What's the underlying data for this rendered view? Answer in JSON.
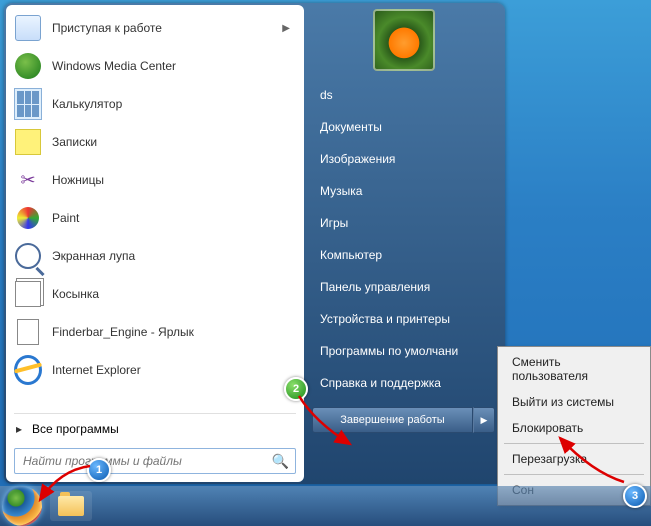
{
  "programs": [
    {
      "label": "Приступая к работе",
      "icon": "getting-started",
      "has_arrow": true
    },
    {
      "label": "Windows Media Center",
      "icon": "wmc",
      "has_arrow": false
    },
    {
      "label": "Калькулятор",
      "icon": "calc",
      "has_arrow": false
    },
    {
      "label": "Записки",
      "icon": "notes",
      "has_arrow": false
    },
    {
      "label": "Ножницы",
      "icon": "scissors",
      "has_arrow": false
    },
    {
      "label": "Paint",
      "icon": "paint",
      "has_arrow": false
    },
    {
      "label": "Экранная лупа",
      "icon": "magnifier",
      "has_arrow": false
    },
    {
      "label": "Косынка",
      "icon": "solitaire",
      "has_arrow": false
    },
    {
      "label": "Finderbar_Engine - Ярлык",
      "icon": "shortcut",
      "has_arrow": false
    },
    {
      "label": "Internet Explorer",
      "icon": "ie",
      "has_arrow": false
    }
  ],
  "all_programs": "Все программы",
  "search_placeholder": "Найти программы и файлы",
  "right_items": [
    "ds",
    "Документы",
    "Изображения",
    "Музыка",
    "Игры",
    "Компьютер",
    "Панель управления",
    "Устройства и принтеры",
    "Программы по умолчани",
    "Справка и поддержка"
  ],
  "shutdown_label": "Завершение работы",
  "submenu": {
    "group1": [
      "Сменить пользователя",
      "Выйти из системы",
      "Блокировать"
    ],
    "group2": [
      "Перезагрузка"
    ],
    "group3": [
      "Сон"
    ]
  },
  "callouts": {
    "c1": "1",
    "c2": "2",
    "c3": "3"
  }
}
